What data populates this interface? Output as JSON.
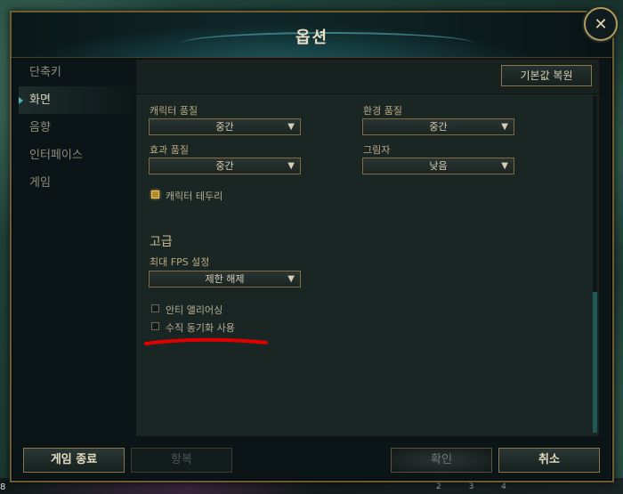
{
  "window": {
    "title": "옵션",
    "close_symbol": "✕"
  },
  "sidebar": {
    "items": [
      {
        "label": "단축키"
      },
      {
        "label": "화면"
      },
      {
        "label": "음향"
      },
      {
        "label": "인터페이스"
      },
      {
        "label": "게임"
      }
    ],
    "active_index": 1
  },
  "content": {
    "reset_label": "기본값 복원",
    "character_quality": {
      "label": "캐릭터 품질",
      "value": "중간"
    },
    "environment_quality": {
      "label": "환경 품질",
      "value": "중간"
    },
    "effects_quality": {
      "label": "효과 품질",
      "value": "중간"
    },
    "shadows": {
      "label": "그림자",
      "value": "낮음"
    },
    "character_outline": {
      "label": "캐릭터 테두리",
      "checked": true
    },
    "advanced": {
      "section_title": "고급",
      "fps_cap": {
        "label": "최대 FPS 설정",
        "value": "제한 해제"
      },
      "anti_aliasing": {
        "label": "안티 앨리어싱",
        "checked": false
      },
      "vsync": {
        "label": "수직 동기화 사용",
        "checked": false
      }
    },
    "dropdown_arrow": "▼"
  },
  "footer": {
    "quit_game": "게임 종료",
    "surrender": "항복",
    "confirm": "확인",
    "cancel": "취소"
  },
  "background": {
    "corner_number": "8",
    "mini_numbers": "2 3 4"
  },
  "colors": {
    "accent_gold": "#8b7748",
    "active_tab_marker": "#4fb3be",
    "annotation_red": "#e10000"
  }
}
